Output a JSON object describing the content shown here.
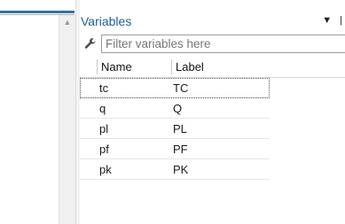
{
  "panel": {
    "title": "Variables",
    "title_icons": "▼ |"
  },
  "filter": {
    "placeholder": "Filter variables here",
    "value": ""
  },
  "columns": {
    "name": "Name",
    "label": "Label"
  },
  "variables": [
    {
      "name": "tc",
      "label": "TC"
    },
    {
      "name": "q",
      "label": "Q"
    },
    {
      "name": "pl",
      "label": "PL"
    },
    {
      "name": "pf",
      "label": "PF"
    },
    {
      "name": "pk",
      "label": "PK"
    }
  ],
  "icons": {
    "filter": "wrench-icon",
    "scroll_up": "chevron-up-icon"
  },
  "colors": {
    "title": "#1f5d8c",
    "accent_line": "#3b6f94"
  }
}
